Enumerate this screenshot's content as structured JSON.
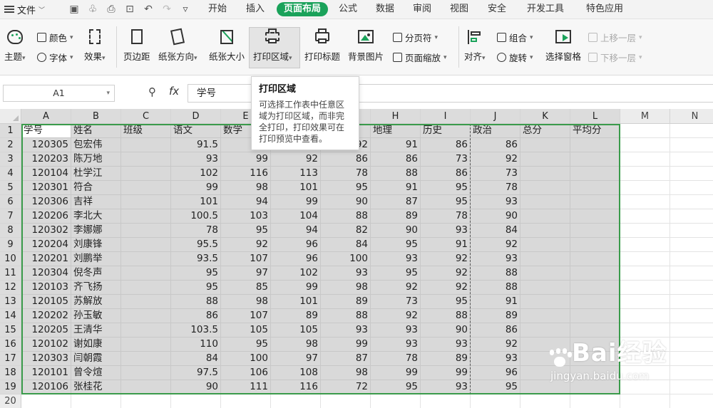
{
  "menubar": {
    "file_label": "文件",
    "tabs": [
      "开始",
      "插入",
      "页面布局",
      "公式",
      "数据",
      "审阅",
      "视图",
      "安全",
      "开发工具",
      "特色应用"
    ],
    "active_tab": "页面布局"
  },
  "ribbon": {
    "theme": "主题",
    "colors": "颜色",
    "fonts": "字体",
    "effects": "效果",
    "margins": "页边距",
    "orientation": "纸张方向",
    "paper_size": "纸张大小",
    "print_area": "打印区域",
    "print_titles": "打印标题",
    "background": "背景图片",
    "page_break": "分页符",
    "page_scale": "页面缩放",
    "align": "对齐",
    "group": "组合",
    "rotate": "旋转",
    "selection_pane": "选择窗格",
    "bring_forward": "上移一层",
    "send_backward": "下移一层"
  },
  "formula_bar": {
    "name_box": "A1",
    "fx": "fx",
    "content": "学号"
  },
  "tooltip": {
    "title": "打印区域",
    "body": "可选择工作表中任意区域为打印区域，而非完全打印，打印效果可在打印预览中查看。"
  },
  "sheet": {
    "columns": [
      "A",
      "B",
      "C",
      "D",
      "E",
      "F",
      "G",
      "H",
      "I",
      "J",
      "K",
      "L",
      "M",
      "N"
    ],
    "header_row": [
      "学号",
      "姓名",
      "班级",
      "语文",
      "数学",
      "",
      "",
      "地理",
      "历史",
      "政治",
      "总分",
      "平均分"
    ],
    "rows": [
      [
        "120305",
        "包宏伟",
        "",
        "91.5",
        "",
        "",
        "92",
        "91",
        "86",
        "86",
        "",
        ""
      ],
      [
        "120203",
        "陈万地",
        "",
        "93",
        "99",
        "92",
        "86",
        "86",
        "73",
        "92",
        "",
        ""
      ],
      [
        "120104",
        "杜学江",
        "",
        "102",
        "116",
        "113",
        "78",
        "88",
        "86",
        "73",
        "",
        ""
      ],
      [
        "120301",
        "符合",
        "",
        "99",
        "98",
        "101",
        "95",
        "91",
        "95",
        "78",
        "",
        ""
      ],
      [
        "120306",
        "吉祥",
        "",
        "101",
        "94",
        "99",
        "90",
        "87",
        "95",
        "93",
        "",
        ""
      ],
      [
        "120206",
        "李北大",
        "",
        "100.5",
        "103",
        "104",
        "88",
        "89",
        "78",
        "90",
        "",
        ""
      ],
      [
        "120302",
        "李娜娜",
        "",
        "78",
        "95",
        "94",
        "82",
        "90",
        "93",
        "84",
        "",
        ""
      ],
      [
        "120204",
        "刘康锋",
        "",
        "95.5",
        "92",
        "96",
        "84",
        "95",
        "91",
        "92",
        "",
        ""
      ],
      [
        "120201",
        "刘鹏举",
        "",
        "93.5",
        "107",
        "96",
        "100",
        "93",
        "92",
        "93",
        "",
        ""
      ],
      [
        "120304",
        "倪冬声",
        "",
        "95",
        "97",
        "102",
        "93",
        "95",
        "92",
        "88",
        "",
        ""
      ],
      [
        "120103",
        "齐飞扬",
        "",
        "95",
        "85",
        "99",
        "98",
        "92",
        "92",
        "88",
        "",
        ""
      ],
      [
        "120105",
        "苏解放",
        "",
        "88",
        "98",
        "101",
        "89",
        "73",
        "95",
        "91",
        "",
        ""
      ],
      [
        "120202",
        "孙玉敏",
        "",
        "86",
        "107",
        "89",
        "88",
        "92",
        "88",
        "89",
        "",
        ""
      ],
      [
        "120205",
        "王清华",
        "",
        "103.5",
        "105",
        "105",
        "93",
        "93",
        "90",
        "86",
        "",
        ""
      ],
      [
        "120102",
        "谢如康",
        "",
        "110",
        "95",
        "98",
        "99",
        "93",
        "93",
        "92",
        "",
        ""
      ],
      [
        "120303",
        "闫朝霞",
        "",
        "84",
        "100",
        "97",
        "87",
        "78",
        "89",
        "93",
        "",
        ""
      ],
      [
        "120101",
        "曾令煊",
        "",
        "97.5",
        "106",
        "108",
        "98",
        "99",
        "99",
        "96",
        "",
        ""
      ],
      [
        "120106",
        "张桂花",
        "",
        "90",
        "111",
        "116",
        "72",
        "95",
        "93",
        "95",
        "",
        ""
      ]
    ]
  },
  "watermark": {
    "brand": "Bai经验",
    "sub": "jingyan.baidu.com"
  }
}
